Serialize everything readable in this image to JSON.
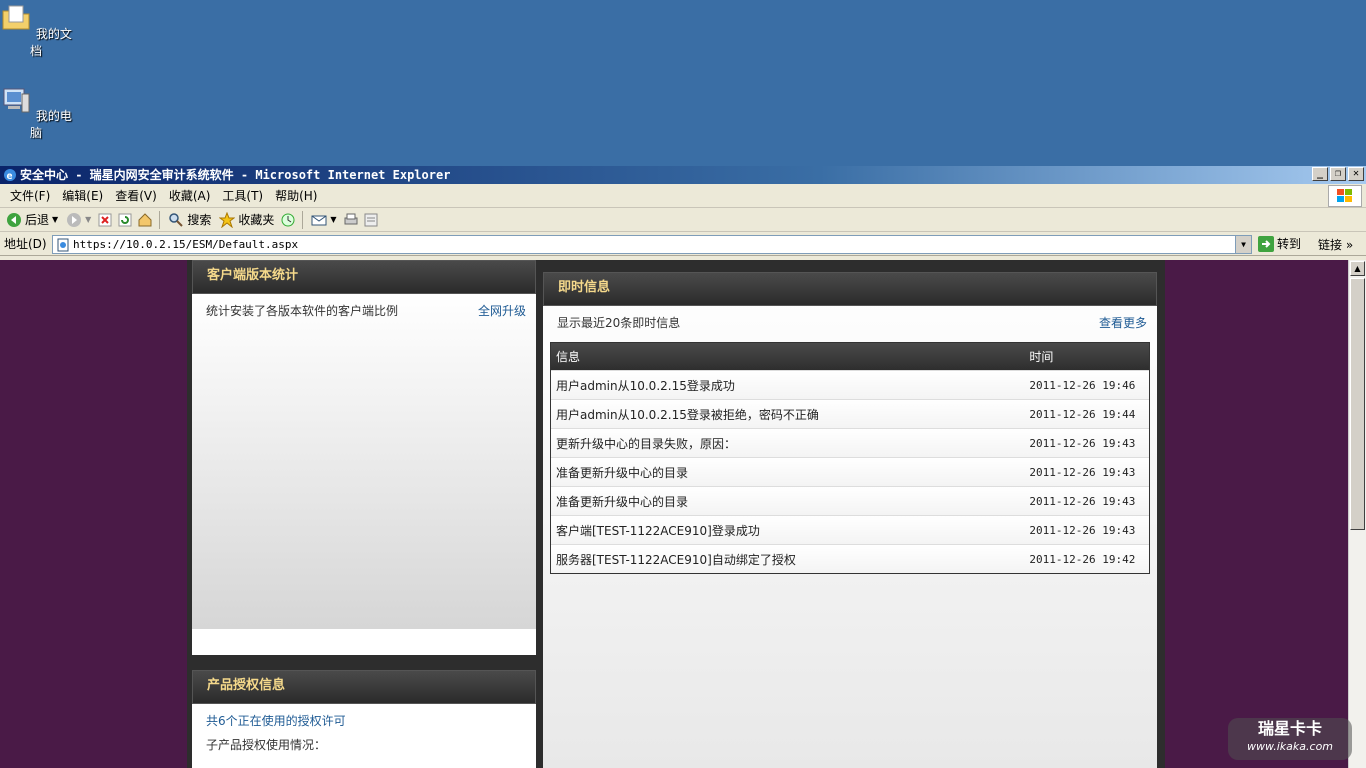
{
  "desktop": {
    "icons": [
      {
        "label": "我的文档"
      },
      {
        "label": "我的电脑"
      }
    ]
  },
  "window": {
    "title": "安全中心 - 瑞星内网安全审计系统软件 - Microsoft Internet Explorer",
    "buttons": {
      "minimize": "_",
      "restore": "❐",
      "close": "✕"
    }
  },
  "menubar": {
    "items": [
      "文件(F)",
      "编辑(E)",
      "查看(V)",
      "收藏(A)",
      "工具(T)",
      "帮助(H)"
    ]
  },
  "toolbar": {
    "back": "后退",
    "search": "搜索",
    "favorites": "收藏夹"
  },
  "address": {
    "label": "地址(D)",
    "url": "https://10.0.2.15/ESM/Default.aspx",
    "go": "转到",
    "links": "链接"
  },
  "left_panel": {
    "title": "客户端版本统计",
    "description": "统计安装了各版本软件的客户端比例",
    "upgrade_link": "全网升级"
  },
  "license_panel": {
    "title": "产品授权信息",
    "link": "共6个正在使用的授权许可",
    "text": "子产品授权使用情况："
  },
  "right_panel": {
    "title": "即时信息",
    "subtitle": "显示最近20条即时信息",
    "more_link": "查看更多",
    "columns": {
      "message": "信息",
      "time": "时间"
    },
    "rows": [
      {
        "message": "用户admin从10.0.2.15登录成功",
        "time": "2011-12-26 19:46"
      },
      {
        "message": "用户admin从10.0.2.15登录被拒绝，密码不正确",
        "time": "2011-12-26 19:44"
      },
      {
        "message": "更新升级中心的目录失败，原因：",
        "time": "2011-12-26 19:43"
      },
      {
        "message": "准备更新升级中心的目录",
        "time": "2011-12-26 19:43"
      },
      {
        "message": "准备更新升级中心的目录",
        "time": "2011-12-26 19:43"
      },
      {
        "message": "客户端[TEST-1122ACE910]登录成功",
        "time": "2011-12-26 19:43"
      },
      {
        "message": "服务器[TEST-1122ACE910]自动绑定了授权",
        "time": "2011-12-26 19:42"
      }
    ]
  },
  "watermark": {
    "title": "瑞星卡卡",
    "url": "www.ikaka.com"
  },
  "colors": {
    "desktop": "#3a6ea5",
    "page_bg": "#4a1a47",
    "panel_header_text": "#f5d98b",
    "link": "#1f5b94"
  }
}
